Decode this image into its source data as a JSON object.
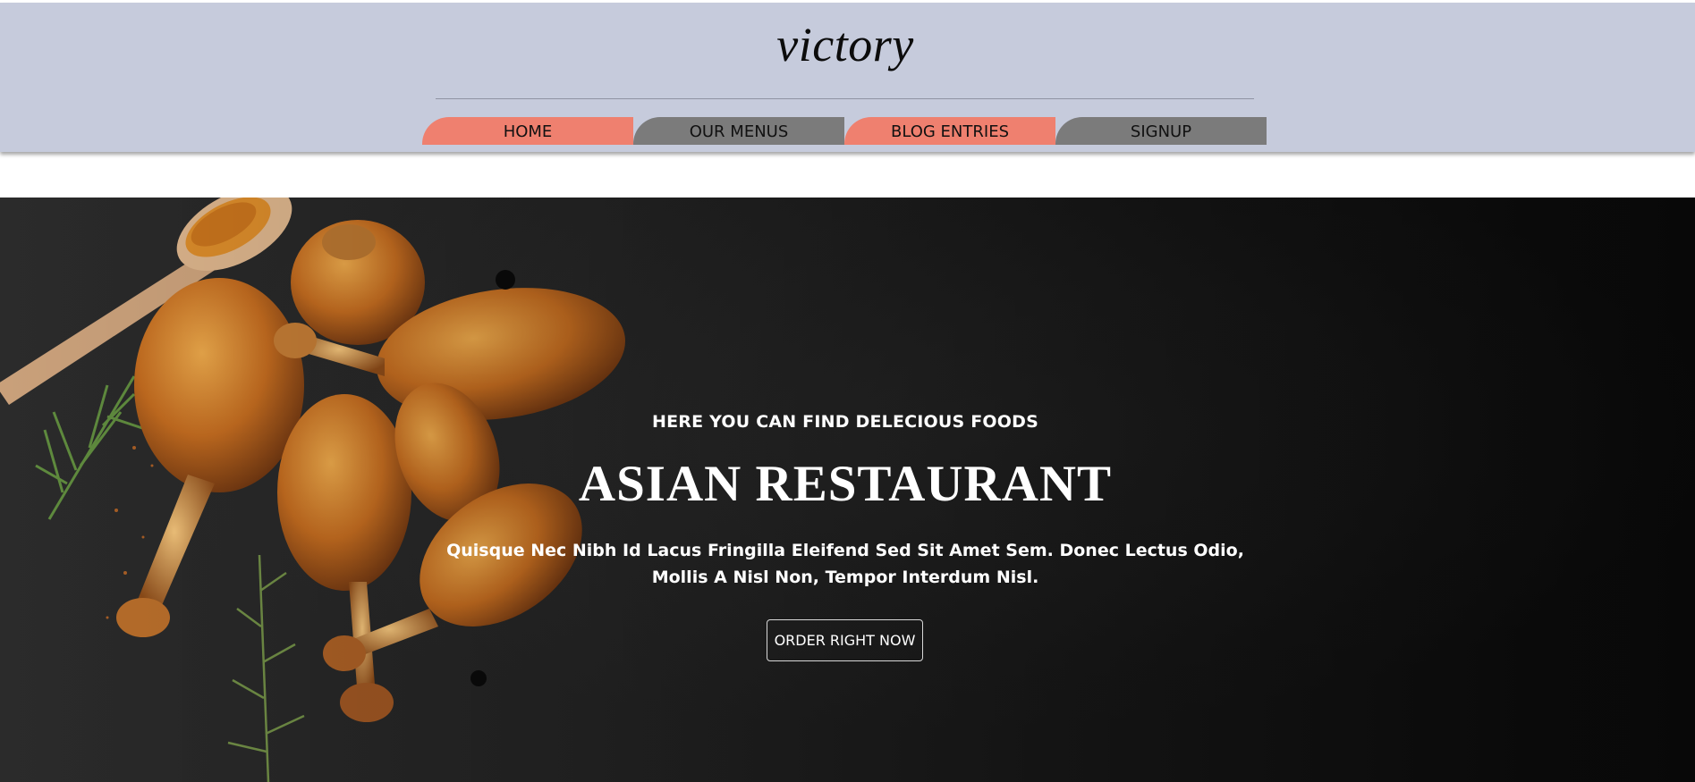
{
  "header": {
    "brand": "victory",
    "nav": [
      {
        "label": "HOME"
      },
      {
        "label": "OUR MENUS"
      },
      {
        "label": "BLOG ENTRIES"
      },
      {
        "label": "SIGNUP"
      }
    ]
  },
  "hero": {
    "tagline": "HERE YOU CAN FIND DELECIOUS FOODS",
    "headline": "ASIAN RESTAURANT",
    "description": "Quisque Nec Nibh Id Lacus Fringilla Eleifend Sed Sit Amet Sem. Donec Lectus Odio, Mollis A Nisl Non, Tempor Interdum Nisl.",
    "cta_label": "ORDER RIGHT NOW",
    "image": "roasted-chicken-drumsticks-photo"
  },
  "colors": {
    "header_bg": "#c6cbdc",
    "nav_salmon": "#ef806f",
    "nav_grey": "#7b7b7b",
    "hero_bg": "#1a1a1a"
  }
}
